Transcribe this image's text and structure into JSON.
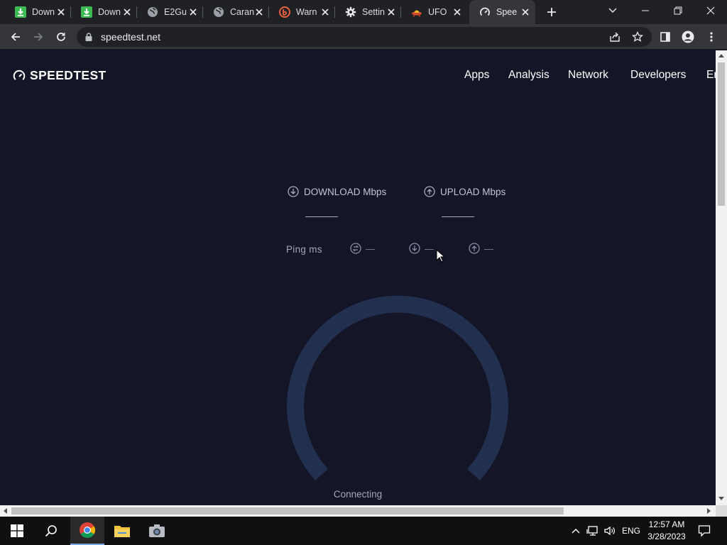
{
  "browser": {
    "tabs": [
      {
        "title": "Down",
        "icon": "download-icon",
        "color": "#3cba54"
      },
      {
        "title": "Down",
        "icon": "download-icon",
        "color": "#3cba54"
      },
      {
        "title": "E2Gu",
        "icon": "globe-icon",
        "color": "#bdc1c6"
      },
      {
        "title": "Caran",
        "icon": "globe-icon",
        "color": "#bdc1c6"
      },
      {
        "title": "Warn",
        "icon": "brand-b-icon",
        "color": "#e8623b"
      },
      {
        "title": "Settin",
        "icon": "gear-icon",
        "color": "#e8eaed"
      },
      {
        "title": "UFO",
        "icon": "ufo-icon",
        "color": "#d14a2a"
      },
      {
        "title": "Spee",
        "icon": "speedtest-icon",
        "color": "#e8eaed",
        "active": true
      }
    ],
    "url": "speedtest.net"
  },
  "site": {
    "logo": "SPEEDTEST",
    "nav": [
      "Apps",
      "Analysis",
      "Network",
      "Developers",
      "Er"
    ]
  },
  "speedtest": {
    "download_label": "DOWNLOAD Mbps",
    "upload_label": "UPLOAD Mbps",
    "ping_label": "Ping  ms",
    "ping_values": [
      "—",
      "—",
      "—"
    ],
    "status": "Connecting"
  },
  "taskbar": {
    "language": "ENG",
    "time": "12:57 AM",
    "date": "3/28/2023"
  },
  "colors": {
    "page_bg": "#141526",
    "gauge_track": "#22304f",
    "accent": "#1cbfff"
  }
}
